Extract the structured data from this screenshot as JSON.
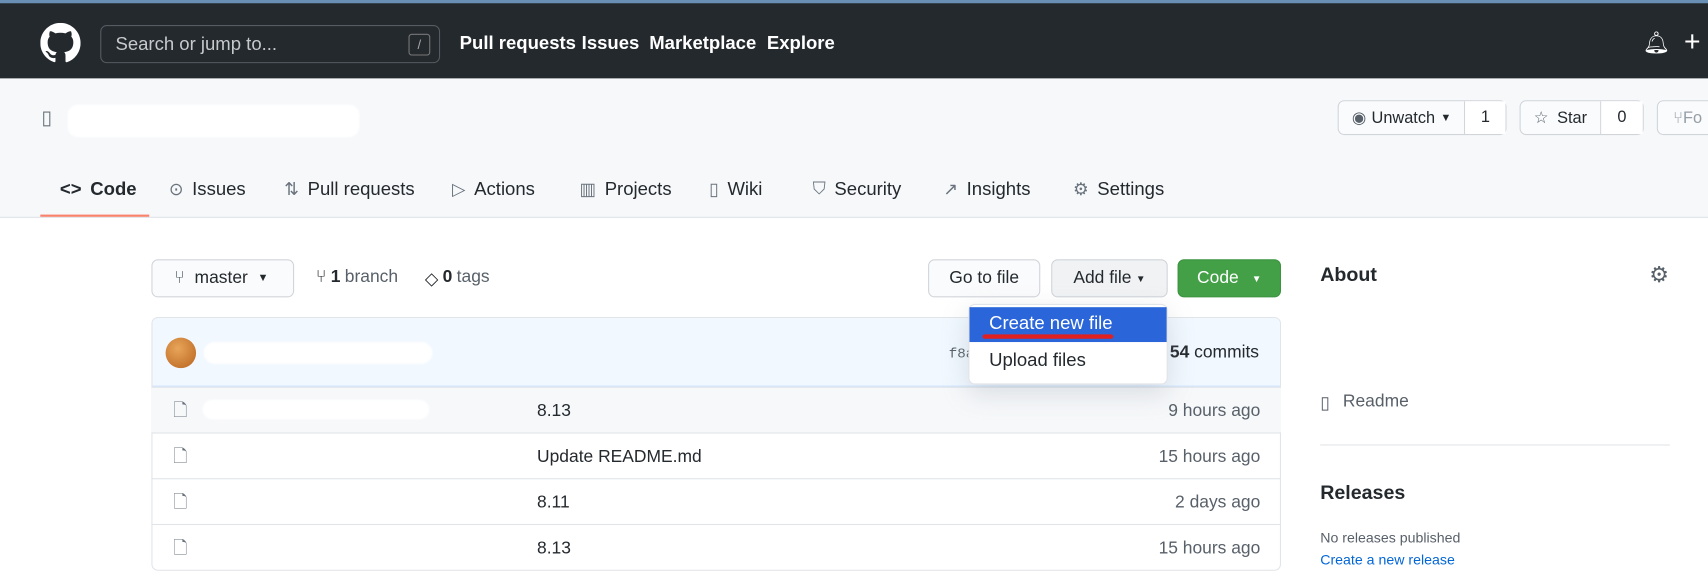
{
  "header": {
    "search_placeholder": "Search or jump to...",
    "slash": "/",
    "nav": [
      "Pull requests",
      "Issues",
      "Marketplace",
      "Explore"
    ],
    "plus": "+"
  },
  "repo": {
    "unwatch": "Unwatch",
    "watch_count": "1",
    "star": "Star",
    "star_count": "0",
    "fork": "Fo"
  },
  "tabs": [
    "Code",
    "Issues",
    "Pull requests",
    "Actions",
    "Projects",
    "Wiki",
    "Security",
    "Insights",
    "Settings"
  ],
  "toolbar": {
    "branch": "master",
    "branch_count": "1",
    "branch_label": "branch",
    "tag_count": "0",
    "tag_label": "tags",
    "go_to_file": "Go to file",
    "add_file": "Add file",
    "code": "Code"
  },
  "dropdown": {
    "items": [
      "Create new file",
      "Upload files"
    ]
  },
  "commit": {
    "hash": "f8a",
    "count": "54",
    "count_label": "commits"
  },
  "files": [
    {
      "message": "8.13",
      "time": "9 hours ago"
    },
    {
      "message": "Update README.md",
      "time": "15 hours ago"
    },
    {
      "message": "8.11",
      "time": "2 days ago"
    },
    {
      "message": "8.13",
      "time": "15 hours ago"
    }
  ],
  "sidebar": {
    "about": "About",
    "readme": "Readme",
    "releases": "Releases",
    "no_releases": "No releases published",
    "create_release": "Create a new release"
  },
  "colors": {
    "header": "#24292e",
    "accent": "#2a66d9",
    "green": "#43a047",
    "tab_underline": "#f9826c",
    "underline_annotation": "#e02020"
  }
}
